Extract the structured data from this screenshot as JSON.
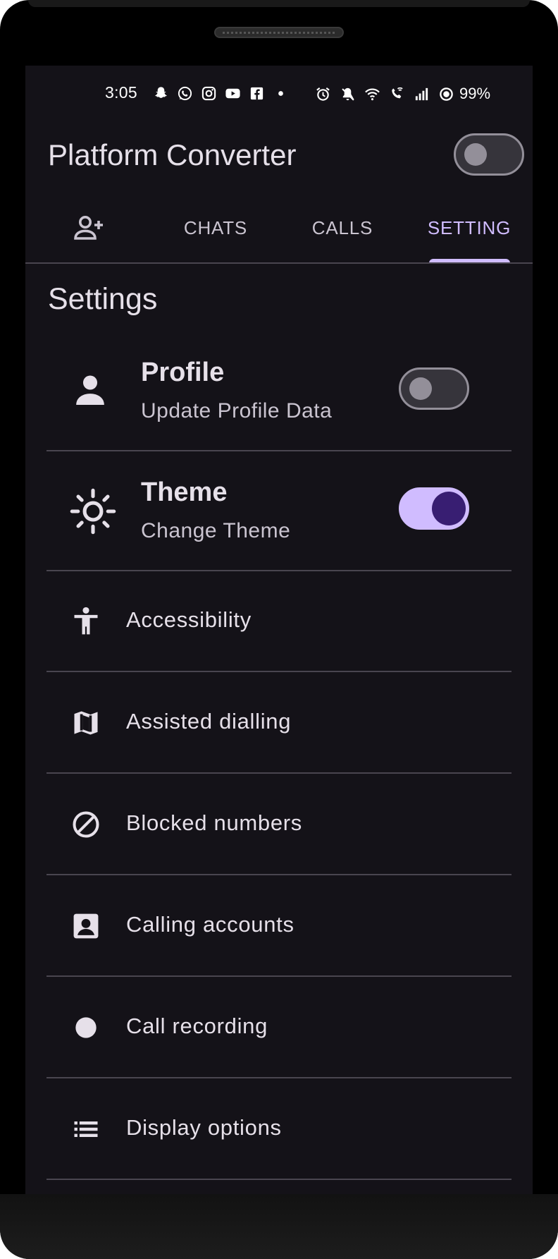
{
  "status_bar": {
    "time": "3:05",
    "left_icons": [
      "snapchat-icon",
      "whatsapp-icon",
      "instagram-icon",
      "youtube-icon",
      "facebook-icon",
      "dot-icon"
    ],
    "right_icons": [
      "alarm-icon",
      "mute-icon",
      "wifi-icon",
      "wifi-calling-icon",
      "signal-icon",
      "battery-saver-icon"
    ],
    "battery": "99%"
  },
  "app_bar": {
    "title": "Platform Converter",
    "toggle_on": false
  },
  "tabs": [
    {
      "icon": "person-add-icon",
      "label": ""
    },
    {
      "label": "CHATS"
    },
    {
      "label": "CALLS"
    },
    {
      "label": "SETTING",
      "active": true
    }
  ],
  "settings": {
    "title": "Settings",
    "profile": {
      "icon": "person-icon",
      "title": "Profile",
      "subtitle": "Update Profile Data",
      "toggle_on": false
    },
    "theme": {
      "icon": "sun-icon",
      "title": "Theme",
      "subtitle": "Change Theme",
      "toggle_on": true
    },
    "items": [
      {
        "icon": "accessibility-icon",
        "label": "Accessibility"
      },
      {
        "icon": "map-icon",
        "label": "Assisted dialling"
      },
      {
        "icon": "block-icon",
        "label": "Blocked numbers"
      },
      {
        "icon": "account-box-icon",
        "label": "Calling accounts"
      },
      {
        "icon": "record-icon",
        "label": "Call recording"
      },
      {
        "icon": "list-icon",
        "label": "Display options"
      }
    ]
  },
  "colors": {
    "background": "#141218",
    "primary": "#d0bcff",
    "on_primary_container": "#381e72",
    "outline": "#938f99",
    "divider": "#49454f",
    "text": "#e6e0e9"
  }
}
